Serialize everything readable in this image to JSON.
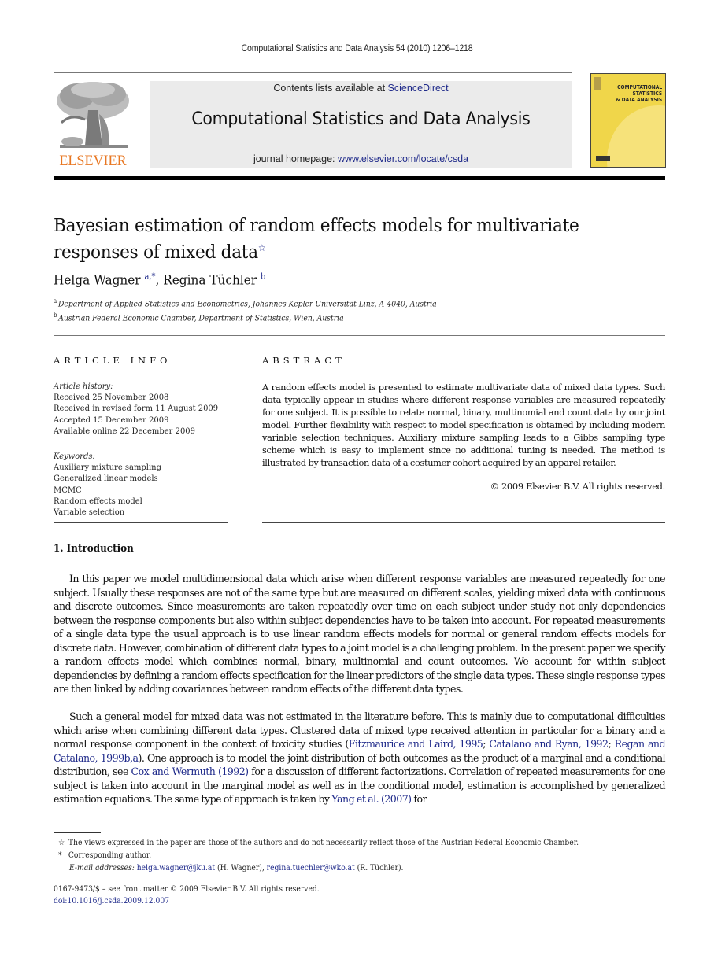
{
  "running_head": "Computational Statistics and Data Analysis 54 (2010) 1206–1218",
  "publisher": {
    "logo_icon": "elsevier-tree-logo-icon",
    "name": "ELSEVIER",
    "brand_color": "#e87722"
  },
  "banner": {
    "contents_prefix": "Contents lists available at ",
    "contents_link": "ScienceDirect",
    "journal_title": "Computational Statistics and Data Analysis",
    "homepage_prefix": "journal homepage: ",
    "homepage_link": "www.elsevier.com/locate/csda",
    "link_color": "#1f2a8a",
    "background": "#ebebeb"
  },
  "cover": {
    "title_lines": [
      "COMPUTATIONAL",
      "STATISTICS",
      "& DATA ANALYSIS"
    ],
    "color": "#f0d64a"
  },
  "article": {
    "title": "Bayesian estimation of random effects models for multivariate responses of mixed data",
    "title_footnote_mark": "☆",
    "authors": [
      {
        "name": "Helga Wagner",
        "marks": "a,*"
      },
      {
        "name": "Regina Tüchler",
        "marks": "b"
      }
    ],
    "author_separator": ", ",
    "affiliations": [
      {
        "mark": "a",
        "text": "Department of Applied Statistics and Econometrics, Johannes Kepler Universität Linz, A-4040, Austria"
      },
      {
        "mark": "b",
        "text": "Austrian Federal Economic Chamber, Department of Statistics, Wien, Austria"
      }
    ]
  },
  "article_info": {
    "heading": "ARTICLE INFO",
    "history_label": "Article history:",
    "history": [
      "Received 25 November 2008",
      "Received in revised form 11 August 2009",
      "Accepted 15 December 2009",
      "Available online 22 December 2009"
    ],
    "keywords_label": "Keywords:",
    "keywords": [
      "Auxiliary mixture sampling",
      "Generalized linear models",
      "MCMC",
      "Random effects model",
      "Variable selection"
    ]
  },
  "abstract": {
    "heading": "ABSTRACT",
    "text": "A random effects model is presented to estimate multivariate data of mixed data types. Such data typically appear in studies where different response variables are measured repeatedly for one subject. It is possible to relate normal, binary, multinomial and count data by our joint model. Further flexibility with respect to model specification is obtained by including modern variable selection techniques. Auxiliary mixture sampling leads to a Gibbs sampling type scheme which is easy to implement since no additional tuning is needed. The method is illustrated by transaction data of a costumer cohort acquired by an apparel retailer.",
    "copyright": "© 2009 Elsevier B.V. All rights reserved."
  },
  "section": {
    "heading": "1.  Introduction",
    "para1": "In this paper we model multidimensional data which arise when different response variables are measured repeatedly for one subject. Usually these responses are not of the same type but are measured on different scales, yielding mixed data with continuous and discrete outcomes. Since measurements are taken repeatedly over time on each subject under study not only dependencies between the response components but also within subject dependencies have to be taken into account. For repeated measurements of a single data type the usual approach is to use linear random effects models for normal or general random effects models for discrete data. However, combination of different data types to a joint model is a challenging problem. In the present paper we specify a random effects model which combines normal, binary, multinomial and count outcomes. We account for within subject dependencies by defining a random effects specification for the linear predictors of the single data types. These single response types are then linked by adding covariances between random effects of the different data types.",
    "para2": {
      "t1": "Such a general model for mixed data was not estimated in the literature before. This is mainly due to computational difficulties which arise when combining different data types. Clustered data of mixed type received attention in particular for a binary and a normal response component in the context of toxicity studies (",
      "c1": "Fitzmaurice and Laird, 1995",
      "s1": "; ",
      "c2": "Catalano and Ryan, 1992",
      "s2": "; ",
      "c3": "Regan and Catalano, 1999b,a",
      "t2": "). One approach is to model the joint distribution of both outcomes as the product of a marginal and a conditional distribution, see ",
      "c4": "Cox and Wermuth (1992)",
      "t3": " for a discussion of different factorizations. Correlation of repeated measurements for one subject is taken into account in the marginal model as well as in the conditional model, estimation is accomplished by generalized estimation equations. The same type of approach is taken by ",
      "c5": "Yang et al. (2007)",
      "t4": " for"
    }
  },
  "footnotes": {
    "star_mark": "☆",
    "star_text": "The views expressed in the paper are those of the authors and do not necessarily reflect those of the Austrian Federal Economic Chamber.",
    "corr_mark": "*",
    "corr_text": "Corresponding author.",
    "email_label": "E-mail addresses:",
    "email1": "helga.wagner@jku.at",
    "email1_owner": " (H. Wagner), ",
    "email2": "regina.tuechler@wko.at",
    "email2_owner": " (R. Tüchler)."
  },
  "front_matter": {
    "issn_line": "0167-9473/$ – see front matter © 2009 Elsevier B.V. All rights reserved.",
    "doi": "doi:10.1016/j.csda.2009.12.007"
  }
}
